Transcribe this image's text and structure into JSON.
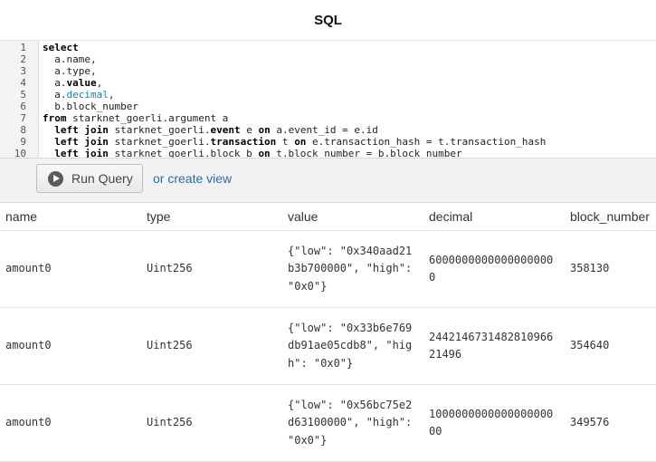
{
  "page": {
    "title": "SQL"
  },
  "editor": {
    "lines": [
      {
        "num": "1",
        "parts": [
          [
            "kw",
            "select"
          ]
        ]
      },
      {
        "num": "2",
        "parts": [
          [
            "t",
            "  a.name,"
          ]
        ]
      },
      {
        "num": "3",
        "parts": [
          [
            "t",
            "  a.type,"
          ]
        ]
      },
      {
        "num": "4",
        "parts": [
          [
            "t",
            "  a."
          ],
          [
            "kw",
            "value"
          ],
          [
            "t",
            ","
          ]
        ]
      },
      {
        "num": "5",
        "parts": [
          [
            "t",
            "  a."
          ],
          [
            "blue",
            "decimal"
          ],
          [
            "t",
            ","
          ]
        ]
      },
      {
        "num": "6",
        "parts": [
          [
            "t",
            "  b.block_number"
          ]
        ]
      },
      {
        "num": "7",
        "parts": [
          [
            "kw",
            "from"
          ],
          [
            "t",
            " starknet_goerli.argument a"
          ]
        ]
      },
      {
        "num": "8",
        "parts": [
          [
            "t",
            "  "
          ],
          [
            "kw",
            "left join"
          ],
          [
            "t",
            " starknet_goerli."
          ],
          [
            "kw",
            "event"
          ],
          [
            "t",
            " e "
          ],
          [
            "kw",
            "on"
          ],
          [
            "t",
            " a.event_id = e.id"
          ]
        ]
      },
      {
        "num": "9",
        "parts": [
          [
            "t",
            "  "
          ],
          [
            "kw",
            "left join"
          ],
          [
            "t",
            " starknet_goerli."
          ],
          [
            "kw",
            "transaction"
          ],
          [
            "t",
            " t "
          ],
          [
            "kw",
            "on"
          ],
          [
            "t",
            " e.transaction_hash = t.transaction_hash"
          ]
        ]
      },
      {
        "num": "10",
        "parts": [
          [
            "t",
            "  "
          ],
          [
            "kw",
            "left join"
          ],
          [
            "t",
            " starknet_goerli.block b "
          ],
          [
            "kw",
            "on"
          ],
          [
            "t",
            " t.block_number = b.block_number"
          ]
        ]
      }
    ]
  },
  "toolbar": {
    "run_label": "Run Query",
    "create_view_label": "or create view"
  },
  "results": {
    "columns": [
      "name",
      "type",
      "value",
      "decimal",
      "block_number"
    ],
    "rows": [
      [
        "amount0",
        "Uint256",
        "{\"low\": \"0x340aad21b3b700000\", \"high\": \"0x0\"}",
        "60000000000000000000",
        "358130"
      ],
      [
        "amount0",
        "Uint256",
        "{\"low\": \"0x33b6e769db91ae05cdb8\", \"high\": \"0x0\"}",
        "244214673148281096621496",
        "354640"
      ],
      [
        "amount0",
        "Uint256",
        "{\"low\": \"0x56bc75e2d63100000\", \"high\": \"0x0\"}",
        "100000000000000000000",
        "349576"
      ]
    ]
  }
}
